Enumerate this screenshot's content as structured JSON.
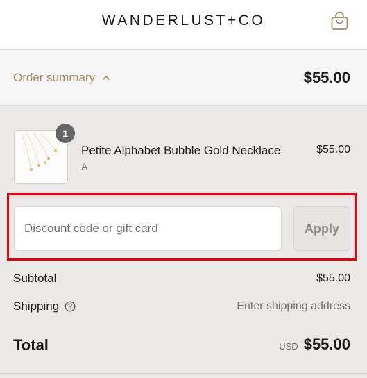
{
  "header": {
    "logo": "WANDERLUST+CO",
    "cart_icon": "shopping-bag-icon",
    "accent_color": "#a08b6b"
  },
  "summary": {
    "toggle_label": "Order summary",
    "toggle_icon": "chevron-up-icon",
    "total": "$55.00"
  },
  "cart_item": {
    "quantity": "1",
    "name": "Petite Alphabet Bubble Gold Necklace",
    "variant": "A",
    "price": "$55.00"
  },
  "discount": {
    "placeholder": "Discount code or gift card",
    "value": "",
    "apply_label": "Apply",
    "highlight_color": "#e8000b"
  },
  "totals": {
    "subtotal_label": "Subtotal",
    "subtotal_value": "$55.00",
    "shipping_label": "Shipping",
    "shipping_icon": "question-circle-icon",
    "shipping_value": "Enter shipping address",
    "total_label": "Total",
    "currency": "USD",
    "total_value": "$55.00"
  }
}
